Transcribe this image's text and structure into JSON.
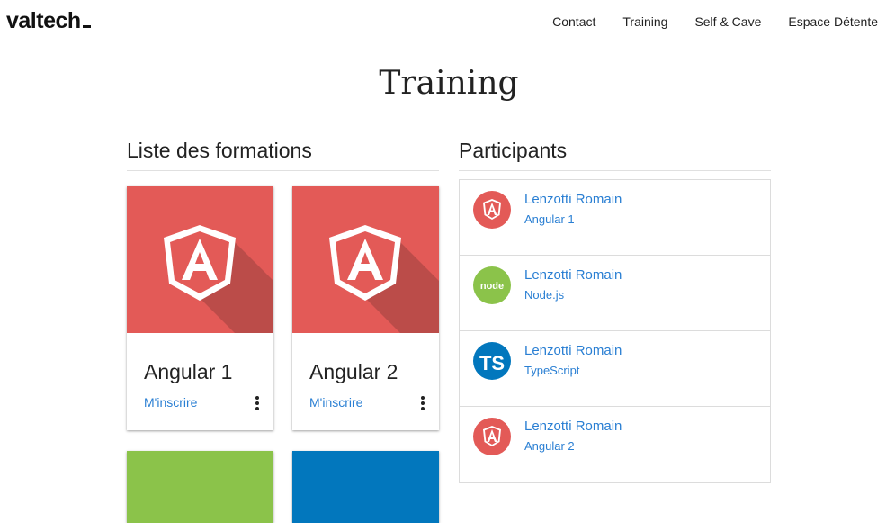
{
  "header": {
    "logo": "valtech",
    "nav": [
      "Contact",
      "Training",
      "Self & Cave",
      "Espace Détente"
    ]
  },
  "page": {
    "title": "Training"
  },
  "formations": {
    "title": "Liste des formations",
    "cards": [
      {
        "name": "Angular 1",
        "action": "M'inscrire",
        "color": "#e35a57",
        "icon": "angular-icon"
      },
      {
        "name": "Angular 2",
        "action": "M'inscrire",
        "color": "#e35a57",
        "icon": "angular-icon"
      },
      {
        "color": "#8bc34a"
      },
      {
        "color": "#0277bd"
      }
    ]
  },
  "participants": {
    "title": "Participants",
    "items": [
      {
        "name": "Lenzotti Romain",
        "course": "Angular 1",
        "icon": "angular-icon"
      },
      {
        "name": "Lenzotti Romain",
        "course": "Node.js",
        "icon": "node-icon"
      },
      {
        "name": "Lenzotti Romain",
        "course": "TypeScript",
        "icon": "typescript-icon"
      },
      {
        "name": "Lenzotti Romain",
        "course": "Angular 2",
        "icon": "angular-icon"
      }
    ]
  },
  "colors": {
    "link": "#2a7fd3",
    "angular": "#e35a57",
    "node": "#8bc34a",
    "typescript": "#0277bd"
  }
}
